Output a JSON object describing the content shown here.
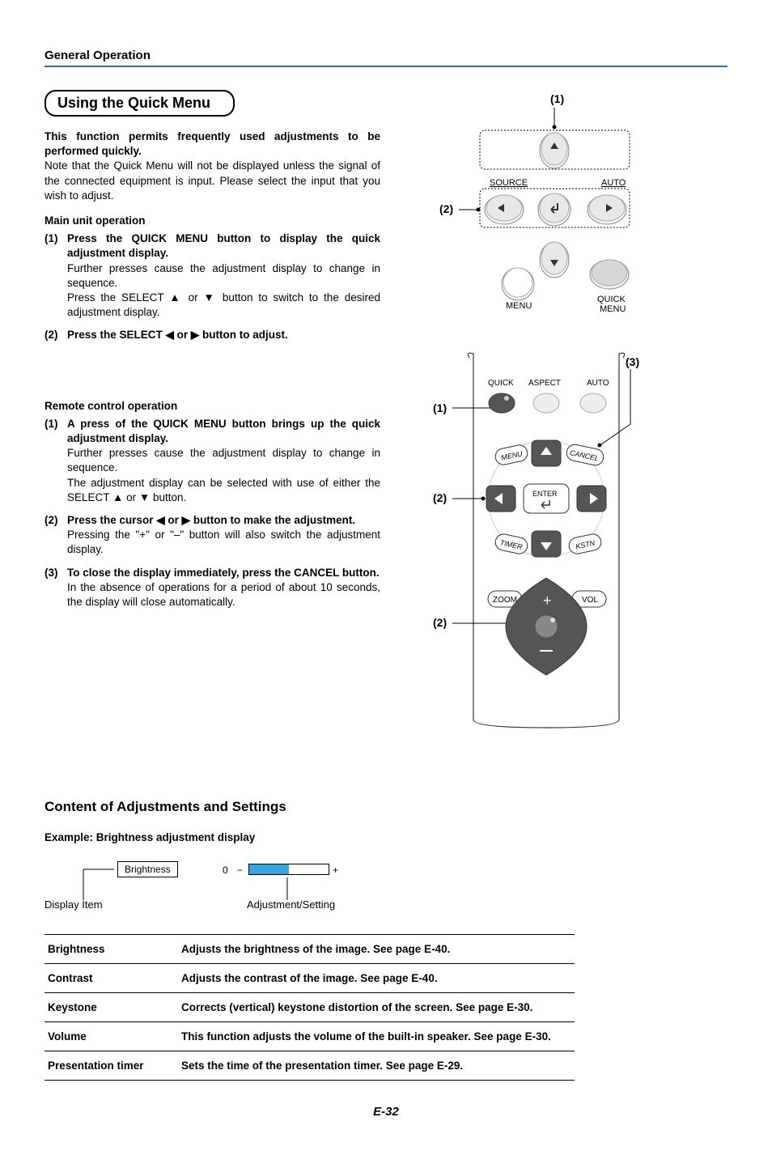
{
  "header": {
    "section": "General Operation"
  },
  "title": "Using the Quick Menu",
  "intro": {
    "lead": "This function permits frequently used adjustments to be performed quickly.",
    "note": "Note that the Quick Menu will not be displayed unless the signal of the connected equipment is input. Please select the input that you wish to adjust."
  },
  "mainUnit": {
    "heading": "Main unit operation",
    "steps": [
      {
        "no": "(1)",
        "head": "Press the QUICK MENU button to display the quick adjustment display.",
        "body1": "Further presses cause the adjustment display to change in sequence.",
        "body2": "Press the SELECT ▲ or ▼ button to switch to the desired adjustment display."
      },
      {
        "no": "(2)",
        "head": "Press the SELECT ◀ or ▶ button to adjust."
      }
    ]
  },
  "remote": {
    "heading": "Remote control operation",
    "steps": [
      {
        "no": "(1)",
        "head": "A press of the QUICK MENU button brings up the quick adjustment display.",
        "body1": "Further presses cause the adjustment display to change in sequence.",
        "body2": "The adjustment display can be selected with use of either the SELECT ▲ or ▼ button."
      },
      {
        "no": "(2)",
        "head": "Press the cursor ◀ or ▶ button to make the adjustment.",
        "body1": "Pressing the \"+\" or \"–\" button will also switch the adjustment display."
      },
      {
        "no": "(3)",
        "head": "To close the display immediately, press the CANCEL button.",
        "body1": "In the absence of operations for a period of about 10 seconds, the display will close automatically."
      }
    ]
  },
  "diagram1": {
    "c1": "(1)",
    "c2": "(2)",
    "labels": {
      "source": "SOURCE",
      "auto": "AUTO",
      "menu": "MENU",
      "quickmenu1": "QUICK",
      "quickmenu2": "MENU"
    }
  },
  "diagram2": {
    "c1": "(1)",
    "c2": "(2)",
    "c2b": "(2)",
    "c3": "(3)",
    "labels": {
      "quick": "QUICK",
      "aspect": "ASPECT",
      "auto": "AUTO",
      "menu": "MENU",
      "cancel": "CANCEL",
      "enter": "ENTER",
      "timer": "TIMER",
      "kstn": "KSTN",
      "zoom": "ZOOM",
      "vol": "VOL",
      "plus": "+",
      "minus": "−"
    }
  },
  "content": {
    "title": "Content of Adjustments and Settings",
    "example": "Example: Brightness adjustment display",
    "brightnessLabel": "Brightness",
    "zero": "0",
    "minus": "−",
    "plus": "+",
    "displayItem": "Display Item",
    "adjSetting": "Adjustment/Setting"
  },
  "table": [
    {
      "name": "Brightness",
      "desc": "Adjusts the brightness of the image. See page E-40."
    },
    {
      "name": "Contrast",
      "desc": "Adjusts the contrast of the image. See page E-40."
    },
    {
      "name": "Keystone",
      "desc": "Corrects (vertical) keystone distortion of the screen.  See page E-30."
    },
    {
      "name": "Volume",
      "desc": "This function adjusts the volume of the built-in speaker. See page E-30."
    },
    {
      "name": "Presentation timer",
      "desc": "Sets the time of the presentation timer.  See page E-29."
    }
  ],
  "pageNo": "E-32"
}
